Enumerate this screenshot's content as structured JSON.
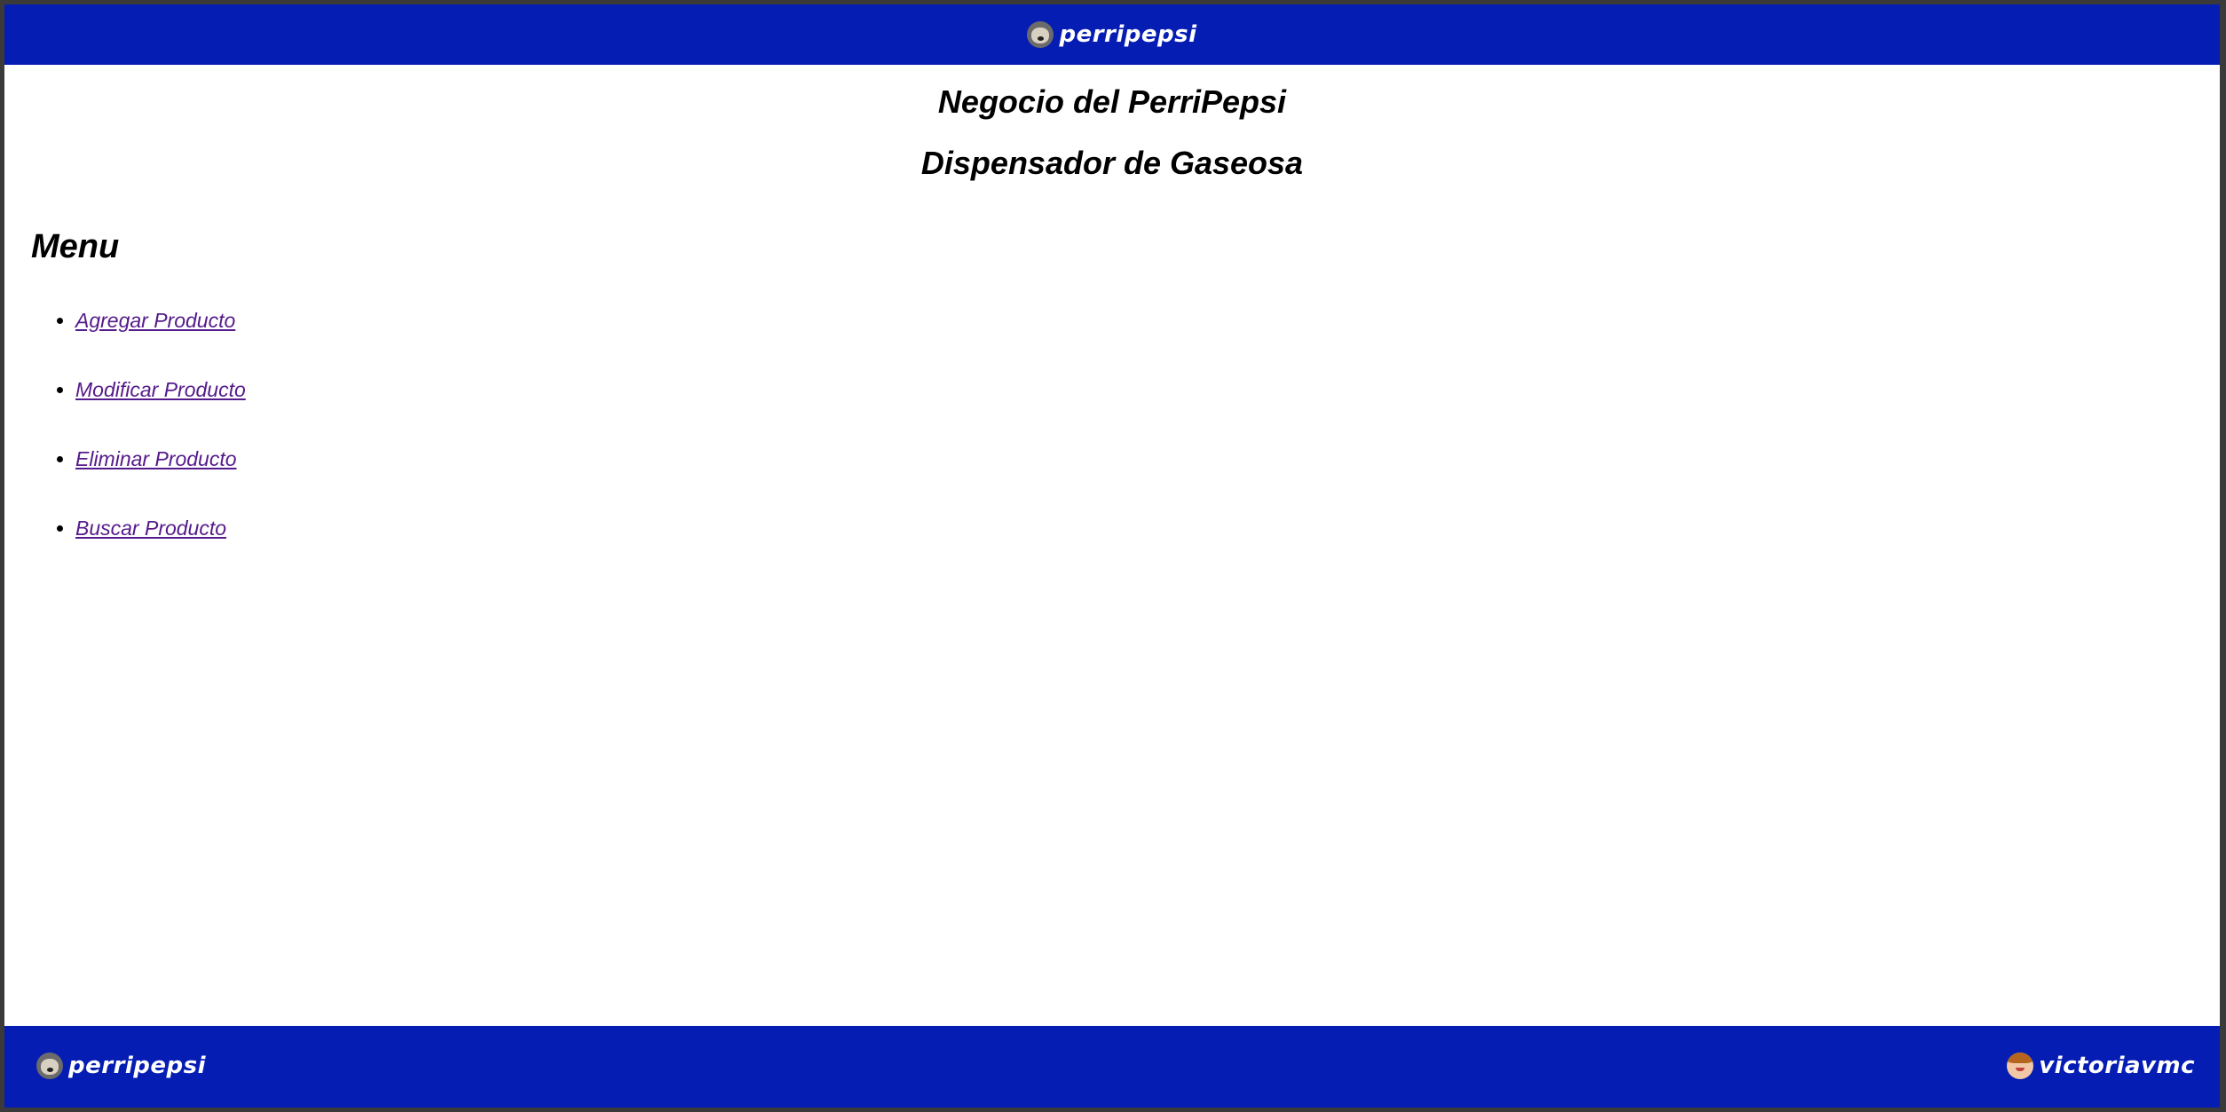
{
  "header": {
    "brand": "perripepsi",
    "brand_icon": "dog-avatar-icon"
  },
  "main": {
    "title": "Negocio del PerriPepsi",
    "subtitle": "Dispensador de Gaseosa",
    "menu_heading": "Menu",
    "menu_items": [
      {
        "label": "Agregar Producto"
      },
      {
        "label": "Modificar Producto"
      },
      {
        "label": "Eliminar Producto"
      },
      {
        "label": "Buscar Producto"
      }
    ]
  },
  "footer": {
    "left_brand": "perripepsi",
    "left_icon": "dog-avatar-icon",
    "right_brand": "victoriavmc",
    "right_icon": "girl-avatar-icon"
  },
  "colors": {
    "bar": "#061db3",
    "link": "#551a8b",
    "background": "#ffffff"
  }
}
